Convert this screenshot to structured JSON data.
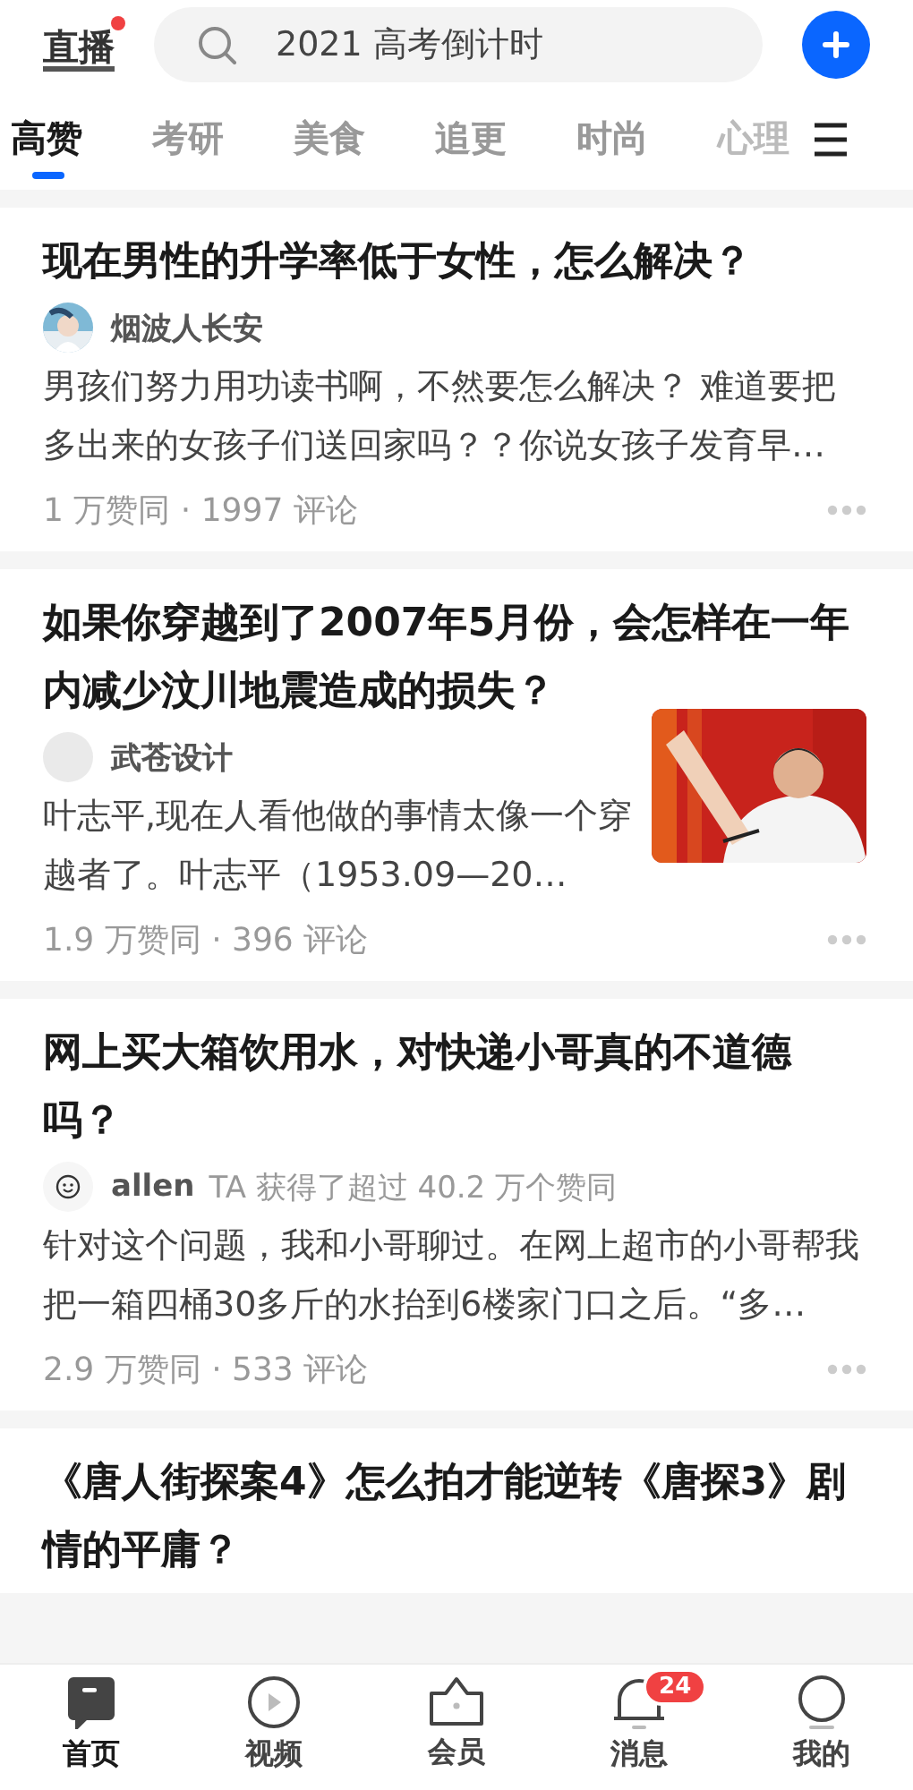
{
  "header": {
    "logo": "直播",
    "logo_dot": true,
    "search": {
      "placeholder": "2021 高考倒计时"
    }
  },
  "tabs": [
    {
      "label": "高赞",
      "selected": true
    },
    {
      "label": "考研",
      "selected": false
    },
    {
      "label": "美食",
      "selected": false
    },
    {
      "label": "追更",
      "selected": false
    },
    {
      "label": "时尚",
      "selected": false
    },
    {
      "label": "心理",
      "selected": false
    }
  ],
  "feed": [
    {
      "title": "现在男性的升学率低于女性，怎么解决？",
      "author": "烟波人长安",
      "excerpt": "男孩们努力用功读书啊，不然要怎么解决？ 难道要把多出来的女孩子们送回家吗？？你说女孩子发育早…",
      "stats": "1 万赞同 · 1997 评论"
    },
    {
      "title": "如果你穿越到了2007年5月份，会怎样在一年内减少汶川地震造成的损失？",
      "avatar": {
        "kind": "plain"
      },
      "author": "武苍设计",
      "excerpt": "叶志平,现在人看他做的事情太像一个穿越者了。叶志平（1953.09—20…",
      "stats": "1.9 万赞同 · 396 评论"
    },
    {
      "title": "网上买大箱饮用水，对快递小哥真的不道德吗？",
      "avatar": {
        "kind": "smiley"
      },
      "author": "allen",
      "author_note": "TA 获得了超过 40.2 万个赞同",
      "excerpt": "针对这个问题，我和小哥聊过。在网上超市的小哥帮我把一箱四桶30多斤的水抬到6楼家门口之后。“多…",
      "stats": "2.9 万赞同 · 533 评论"
    },
    {
      "title": "《唐人街探案4》怎么拍才能逆转《唐探3》剧情的平庸？"
    }
  ],
  "nav": [
    {
      "label": "首页",
      "kind": "home",
      "selected": true
    },
    {
      "label": "视频",
      "kind": "video",
      "selected": false
    },
    {
      "label": "会员",
      "kind": "crown",
      "selected": false
    },
    {
      "label": "消息",
      "kind": "bell",
      "selected": false,
      "badge": "24"
    },
    {
      "label": "我的",
      "kind": "profile",
      "selected": false
    }
  ]
}
